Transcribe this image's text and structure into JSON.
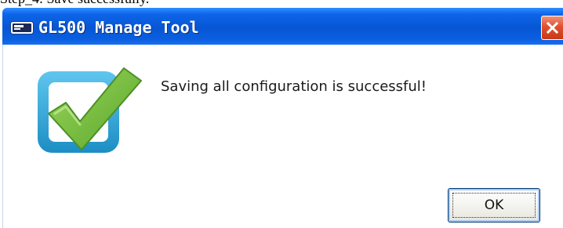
{
  "document": {
    "caption_above": "Step_4: Save successfully."
  },
  "dialog": {
    "title": "GL500 Manage Tool",
    "title_icon": "app-window-icon",
    "close_icon": "close-icon",
    "message": "Saving all configuration is successful!",
    "status_icon": "success-checkmark-icon",
    "ok_label": "OK"
  },
  "colors": {
    "titlebar": "#0756d4",
    "close_button": "#e0502e",
    "checkmark_green": "#7cc243",
    "icon_frame_blue": "#2aa7d8"
  }
}
